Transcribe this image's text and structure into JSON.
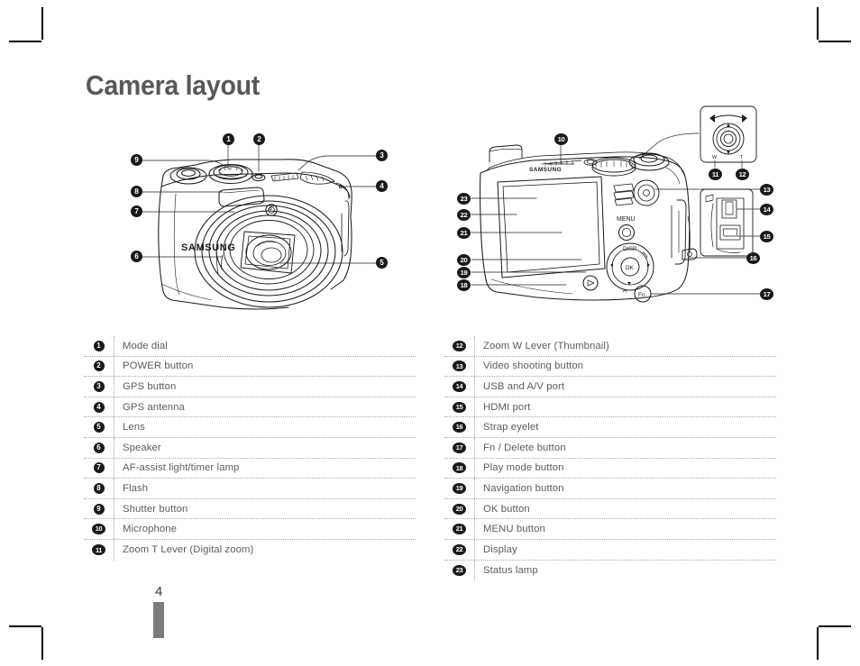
{
  "document": {
    "title": "Camera layout",
    "page_number": "4",
    "brand": "SAMSUNG"
  },
  "figures": {
    "front": {
      "name": "camera-front-view",
      "brand_text": "SAMSUNG",
      "callouts": [
        "1",
        "2",
        "3",
        "4",
        "5",
        "6",
        "7",
        "8",
        "9"
      ]
    },
    "back": {
      "name": "camera-back-view",
      "brand_text": "SAMSUNG",
      "menu_label": "MENU",
      "disp_label": "DISP",
      "ok_label": "OK",
      "fn_label": "Fn",
      "zoom_inset": {
        "w_label": "W",
        "t_label": "T"
      },
      "callouts": [
        "10",
        "11",
        "12",
        "13",
        "14",
        "15",
        "16",
        "17",
        "18",
        "19",
        "20",
        "21",
        "22",
        "23"
      ]
    }
  },
  "tables": {
    "left": [
      {
        "num": "1",
        "label": "Mode dial"
      },
      {
        "num": "2",
        "label": "POWER button"
      },
      {
        "num": "3",
        "label": "GPS button"
      },
      {
        "num": "4",
        "label": "GPS antenna"
      },
      {
        "num": "5",
        "label": "Lens"
      },
      {
        "num": "6",
        "label": "Speaker"
      },
      {
        "num": "7",
        "label": "AF-assist light/timer lamp"
      },
      {
        "num": "8",
        "label": "Flash"
      },
      {
        "num": "9",
        "label": "Shutter button"
      },
      {
        "num": "10",
        "label": "Microphone"
      },
      {
        "num": "11",
        "label": "Zoom T Lever (Digital zoom)"
      }
    ],
    "right": [
      {
        "num": "12",
        "label": "Zoom W Lever (Thumbnail)"
      },
      {
        "num": "13",
        "label": "Video shooting button"
      },
      {
        "num": "14",
        "label": "USB and A/V port"
      },
      {
        "num": "15",
        "label": "HDMI port"
      },
      {
        "num": "16",
        "label": "Strap eyelet"
      },
      {
        "num": "17",
        "label": "Fn / Delete button"
      },
      {
        "num": "18",
        "label": "Play mode button"
      },
      {
        "num": "19",
        "label": "Navigation button"
      },
      {
        "num": "20",
        "label": "OK button"
      },
      {
        "num": "21",
        "label": "MENU button"
      },
      {
        "num": "22",
        "label": "Display"
      },
      {
        "num": "23",
        "label": "Status lamp"
      }
    ]
  },
  "colors": {
    "title": "#58585a",
    "table_text": "#5c5c5c",
    "rule": "#3b3b3b",
    "dotted": "#a8a8a8",
    "bullet": "#1a1a1a",
    "page_tab": "#7c7c7c"
  }
}
